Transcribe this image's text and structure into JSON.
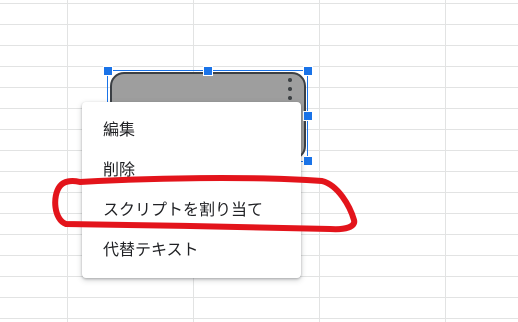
{
  "context_menu": {
    "items": [
      {
        "label": "編集"
      },
      {
        "label": "削除"
      },
      {
        "label": "スクリプトを割り当て"
      },
      {
        "label": "代替テキスト"
      }
    ]
  },
  "drawing": {
    "fill_color": "#9e9e9e",
    "border_color": "#3b3f44",
    "selection_color": "#1a73e8",
    "more_options_icon": "more-vert-icon"
  },
  "annotation": {
    "color": "#e3141b",
    "highlighted_item": "スクリプトを割り当て"
  }
}
